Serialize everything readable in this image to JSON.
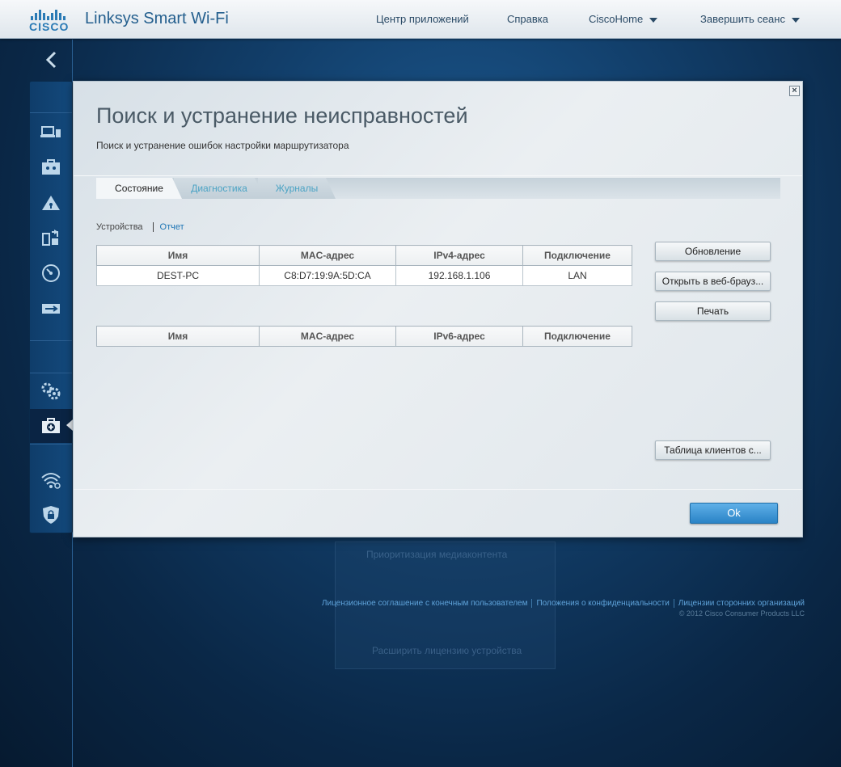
{
  "header": {
    "brand_word": "CISCO",
    "app_title": "Linksys Smart Wi-Fi",
    "nav": {
      "app_center": "Центр приложений",
      "help": "Справка",
      "account": "CiscoHome",
      "logout": "Завершить сеанс"
    }
  },
  "sidebar": {
    "items": [
      "device-list-icon",
      "guest-access-icon",
      "parental-controls-icon",
      "media-prioritization-icon",
      "speed-test-icon",
      "usb-storage-icon",
      "connectivity-icon",
      "troubleshooting-icon",
      "wireless-icon",
      "security-icon"
    ],
    "active": "troubleshooting"
  },
  "modal": {
    "close": "×",
    "title": "Поиск и устранение неисправностей",
    "subtitle": "Поиск и устранение ошибок настройки маршрутизатора",
    "tabs": [
      "Состояние",
      "Диагностика",
      "Журналы"
    ],
    "subnav": {
      "devices": "Устройства",
      "report": "Отчет"
    },
    "ipv4_table": {
      "headers": [
        "Имя",
        "MAC-адрес",
        "IPv4-адрес",
        "Подключение"
      ],
      "rows": [
        [
          "DEST-PC",
          "C8:D7:19:9A:5D:CA",
          "192.168.1.106",
          "LAN"
        ]
      ]
    },
    "ipv6_table": {
      "headers": [
        "Имя",
        "MAC-адрес",
        "IPv6-адрес",
        "Подключение"
      ],
      "rows": []
    },
    "buttons": {
      "refresh": "Обновление",
      "open_browser": "Открыть в веб-брауз...",
      "print": "Печать",
      "client_table": "Таблица клиентов с..."
    },
    "ok": "Ok"
  },
  "background": {
    "ghost_title": "Приоритизация медиаконтента",
    "ghost_link": "Расширить лицензию устройства"
  },
  "footer": {
    "links": [
      "Лицензионное соглашение с конечным пользователем",
      "Положения о конфиденциальности",
      "Лицензии сторонних организаций"
    ],
    "copyright": "© 2012 Cisco Consumer Products LLC"
  },
  "colors": {
    "accent": "#2a7ab5",
    "ok_button": "#3a93d4",
    "tab_link": "#4ba3c4",
    "background_dark": "#0a2746"
  }
}
